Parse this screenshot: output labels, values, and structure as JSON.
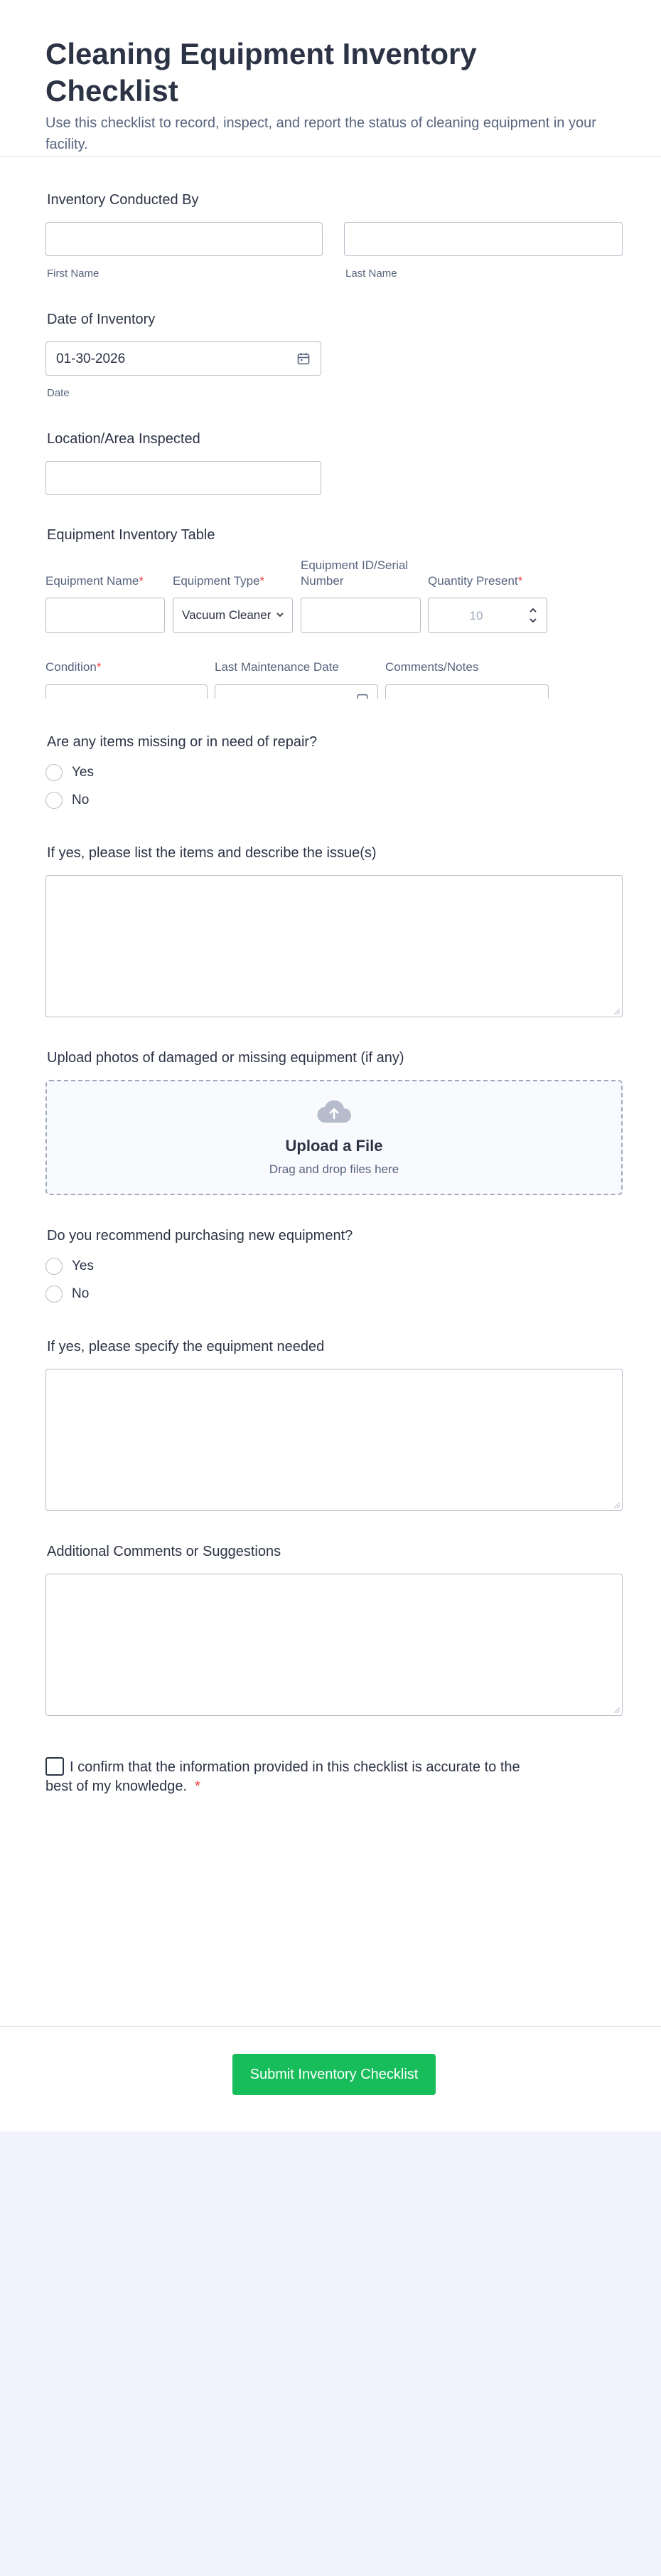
{
  "form": {
    "title": "Cleaning Equipment Inventory Checklist",
    "subtitle": "Use this checklist to record, inspect, and report the status of cleaning equipment in your facility."
  },
  "inventory_by": {
    "label": "Inventory Conducted By",
    "first_name_value": "",
    "last_name_value": "",
    "first_name_sublabel": "First Name",
    "last_name_sublabel": "Last Name"
  },
  "date": {
    "label": "Date of Inventory",
    "value": "01-30-2026",
    "sublabel": "Date",
    "icon": "calendar-icon"
  },
  "location": {
    "label": "Location/Area Inspected",
    "value": ""
  },
  "table": {
    "label": "Equipment Inventory Table",
    "columns": {
      "name": "Equipment Name",
      "type": "Equipment Type",
      "serial": "Equipment ID/Serial Number",
      "qty": "Quantity Present",
      "condition": "Condition",
      "maintenance": "Last Maintenance Date",
      "comments": "Comments/Notes"
    },
    "type_selected": "Vacuum Cleaner",
    "qty_placeholder": "10",
    "required_mark": "*"
  },
  "repair": {
    "question": "Are any items missing or in need of repair?",
    "options": [
      "Yes",
      "No"
    ]
  },
  "repair_details": {
    "label": "If yes, please list the items and describe the issue(s)",
    "value": ""
  },
  "upload": {
    "label": "Upload photos of damaged or missing equipment (if any)",
    "title": "Upload a File",
    "hint": "Drag and drop files here",
    "icon": "cloud-upload-icon"
  },
  "recommend": {
    "question": "Do you recommend purchasing new equipment?",
    "options": [
      "Yes",
      "No"
    ]
  },
  "equipment_needed": {
    "label": "If yes, please specify the equipment needed",
    "value": ""
  },
  "additional": {
    "label": "Additional Comments or Suggestions",
    "value": ""
  },
  "confirm": {
    "text": "I confirm that the information provided in this checklist is accurate to the best of my knowledge.",
    "required_mark": "*"
  },
  "submit": {
    "label": "Submit Inventory Checklist"
  },
  "colors": {
    "accent": "#18bd5b",
    "required": "#f23a3c",
    "text": "#2c3345",
    "muted": "#57647e",
    "page_background": "#f3f3fe"
  }
}
